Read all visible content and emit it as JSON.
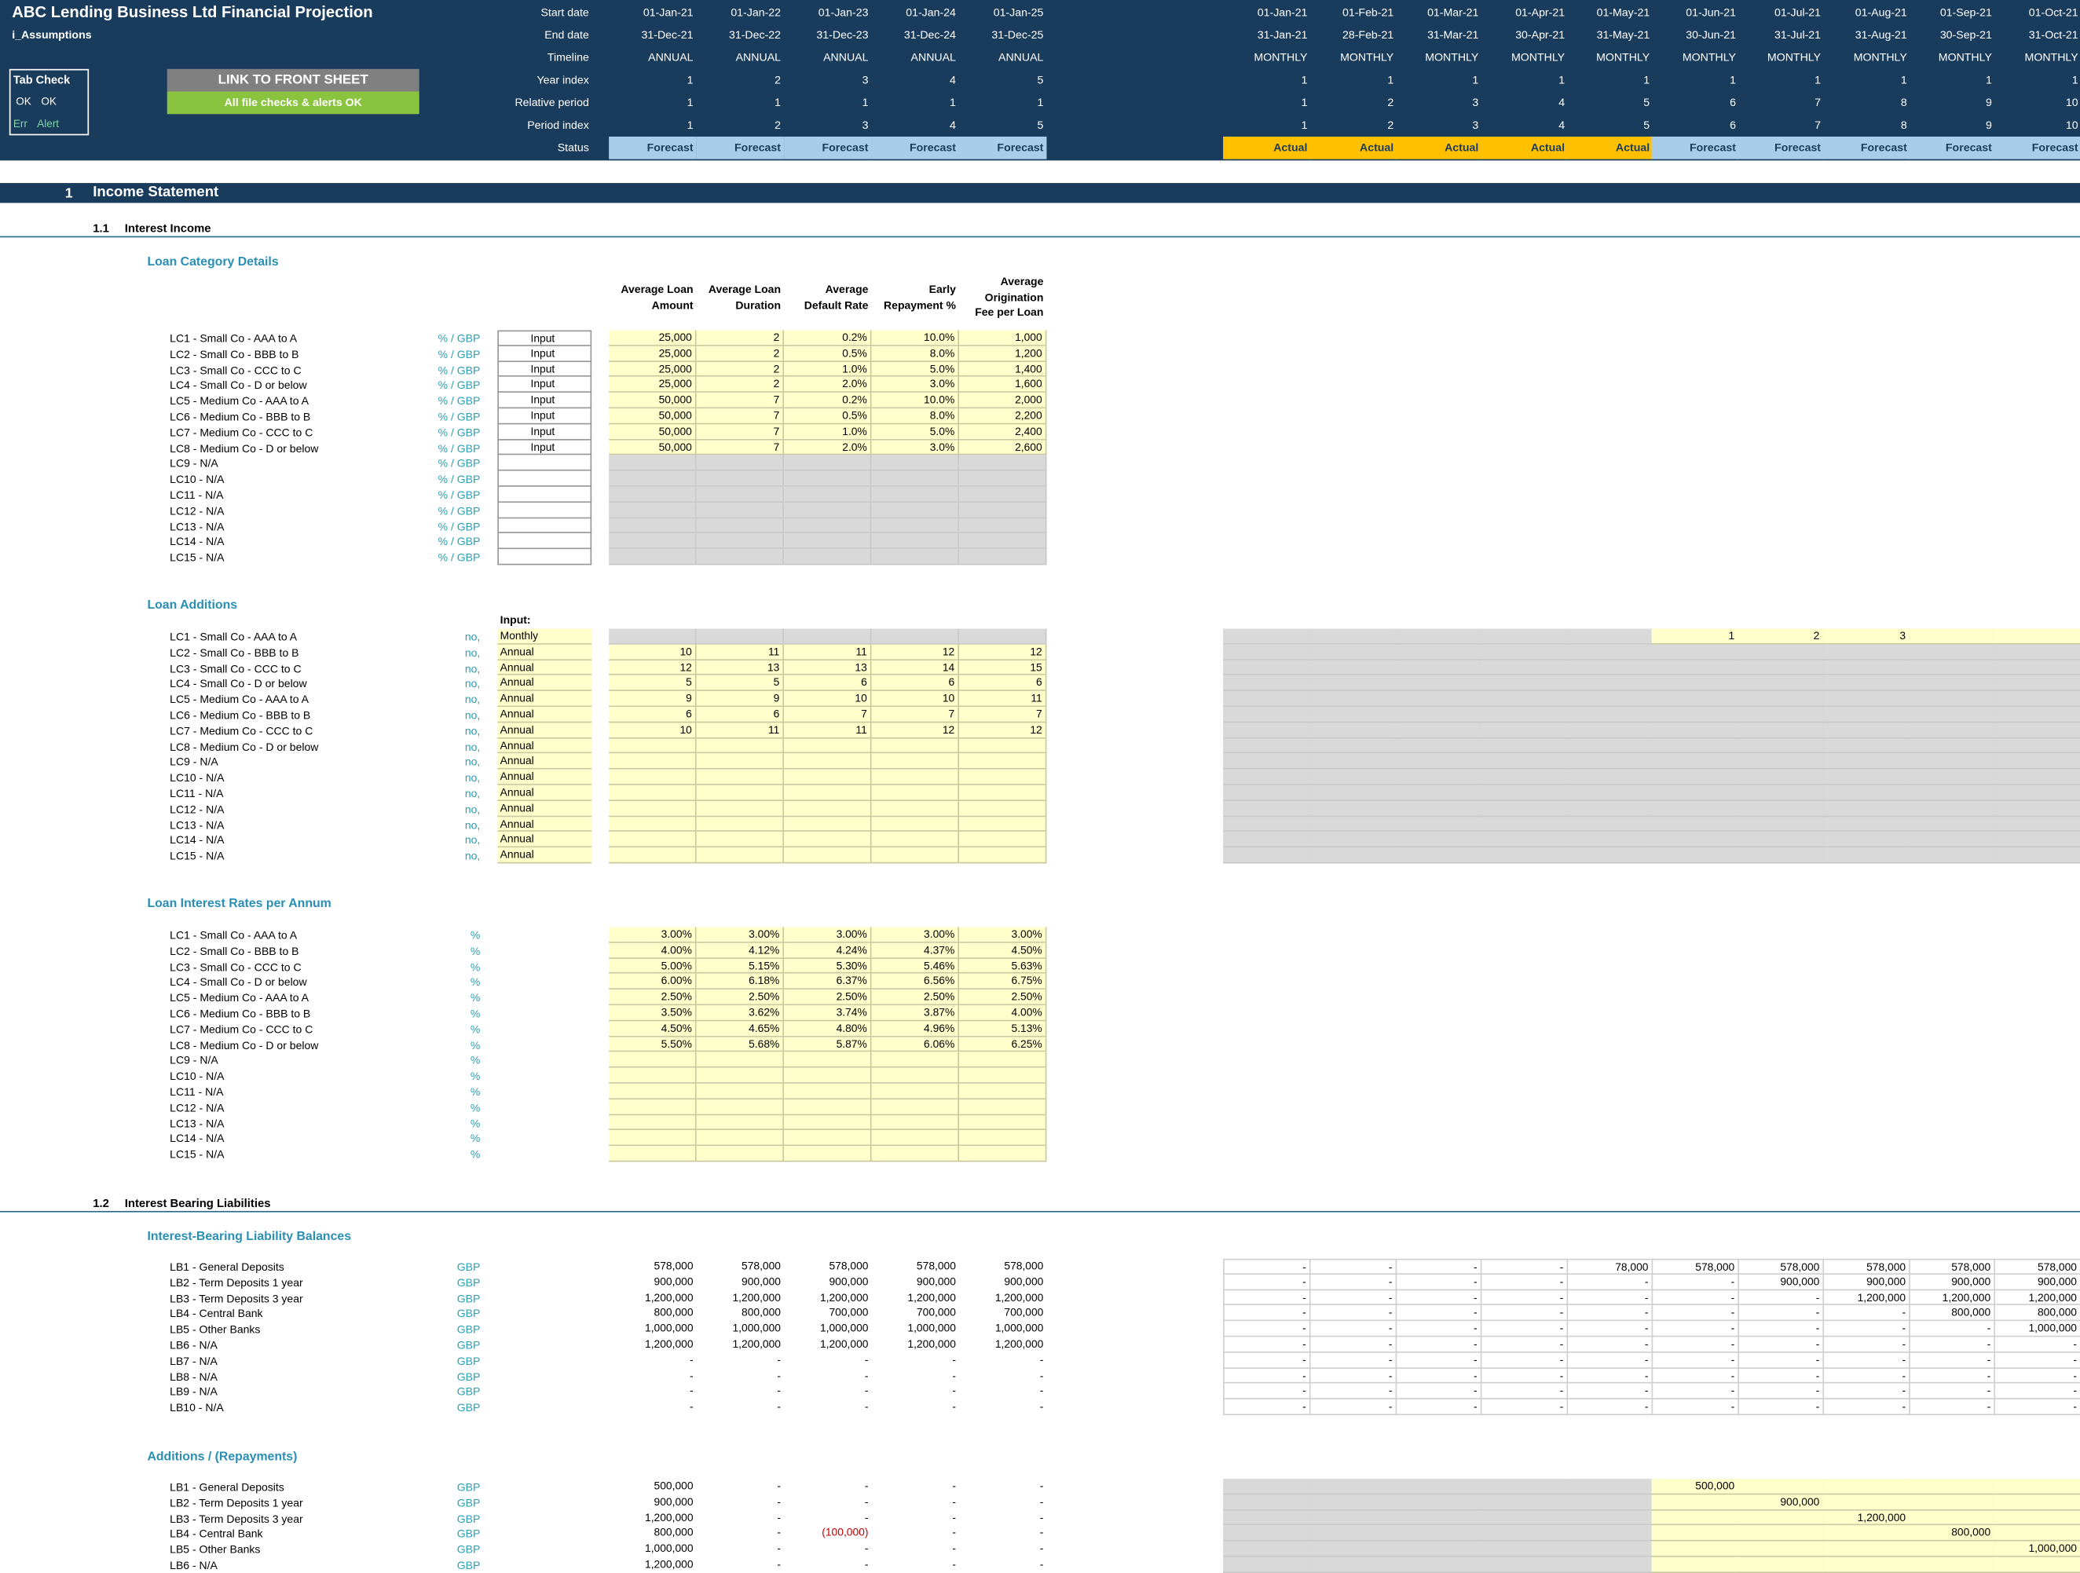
{
  "header": {
    "title": "ABC Lending Business Ltd Financial Projection",
    "sheet_name": "i_Assumptions",
    "tab_check": {
      "label": "Tab Check",
      "ok1": "OK",
      "ok2": "OK",
      "err": "Err",
      "alert": "Alert"
    },
    "link_button": "LINK TO FRONT SHEET",
    "checks_status": "All file checks & alerts OK",
    "row_labels": [
      "Start date",
      "End date",
      "Timeline",
      "Year index",
      "Relative period",
      "Period index",
      "Status"
    ],
    "annual": {
      "start": [
        "01-Jan-21",
        "01-Jan-22",
        "01-Jan-23",
        "01-Jan-24",
        "01-Jan-25"
      ],
      "end": [
        "31-Dec-21",
        "31-Dec-22",
        "31-Dec-23",
        "31-Dec-24",
        "31-Dec-25"
      ],
      "timeline": [
        "ANNUAL",
        "ANNUAL",
        "ANNUAL",
        "ANNUAL",
        "ANNUAL"
      ],
      "year_index": [
        "1",
        "2",
        "3",
        "4",
        "5"
      ],
      "relative": [
        "1",
        "1",
        "1",
        "1",
        "1"
      ],
      "period": [
        "1",
        "2",
        "3",
        "4",
        "5"
      ],
      "status": [
        "Forecast",
        "Forecast",
        "Forecast",
        "Forecast",
        "Forecast"
      ]
    },
    "monthly": {
      "start": [
        "01-Jan-21",
        "01-Feb-21",
        "01-Mar-21",
        "01-Apr-21",
        "01-May-21",
        "01-Jun-21",
        "01-Jul-21",
        "01-Aug-21",
        "01-Sep-21",
        "01-Oct-21"
      ],
      "end": [
        "31-Jan-21",
        "28-Feb-21",
        "31-Mar-21",
        "30-Apr-21",
        "31-May-21",
        "30-Jun-21",
        "31-Jul-21",
        "31-Aug-21",
        "30-Sep-21",
        "31-Oct-21"
      ],
      "timeline": [
        "MONTHLY",
        "MONTHLY",
        "MONTHLY",
        "MONTHLY",
        "MONTHLY",
        "MONTHLY",
        "MONTHLY",
        "MONTHLY",
        "MONTHLY",
        "MONTHLY"
      ],
      "year_index": [
        "1",
        "1",
        "1",
        "1",
        "1",
        "1",
        "1",
        "1",
        "1",
        "1"
      ],
      "relative": [
        "1",
        "2",
        "3",
        "4",
        "5",
        "6",
        "7",
        "8",
        "9",
        "10"
      ],
      "period": [
        "1",
        "2",
        "3",
        "4",
        "5",
        "6",
        "7",
        "8",
        "9",
        "10"
      ],
      "status": [
        "Actual",
        "Actual",
        "Actual",
        "Actual",
        "Actual",
        "Forecast",
        "Forecast",
        "Forecast",
        "Forecast",
        "Forecast"
      ]
    }
  },
  "colors": {
    "header_bg": "#1a3c5c",
    "forecast": "#a9cce9",
    "actual": "#ffc000",
    "input": "#ffffcc",
    "grey": "#d9d9d9",
    "link_button": "#808080",
    "checks_ok": "#8ac43f",
    "heading_teal": "#2a8fb5"
  },
  "section1": {
    "num": "1",
    "title": "Income Statement"
  },
  "s11": {
    "num": "1.1",
    "title": "Interest Income"
  },
  "s12": {
    "num": "1.2",
    "title": "Interest Bearing Liabilities"
  },
  "loan_cat": {
    "title": "Loan Category Details",
    "headers": [
      [
        "Average Loan",
        "Amount"
      ],
      [
        "Average Loan",
        "Duration"
      ],
      [
        "Average",
        "Default Rate"
      ],
      [
        "Early",
        "Repayment %"
      ],
      [
        "Average",
        "Origination",
        "Fee per Loan"
      ]
    ],
    "labels": [
      "LC1 - Small Co - AAA to A",
      "LC2 - Small Co - BBB to B",
      "LC3 - Small Co - CCC to C",
      "LC4 - Small Co - D or below",
      "LC5 - Medium Co - AAA to A",
      "LC6 - Medium Co - BBB to B",
      "LC7 - Medium Co - CCC to C",
      "LC8 - Medium Co - D or below",
      "LC9 - N/A",
      "LC10 - N/A",
      "LC11 - N/A",
      "LC12 - N/A",
      "LC13 - N/A",
      "LC14 - N/A",
      "LC15 - N/A"
    ],
    "unit": "% / GBP",
    "input_label": "Input",
    "values": [
      [
        "25,000",
        "2",
        "0.2%",
        "10.0%",
        "1,000"
      ],
      [
        "25,000",
        "2",
        "0.5%",
        "8.0%",
        "1,200"
      ],
      [
        "25,000",
        "2",
        "1.0%",
        "5.0%",
        "1,400"
      ],
      [
        "25,000",
        "2",
        "2.0%",
        "3.0%",
        "1,600"
      ],
      [
        "50,000",
        "7",
        "0.2%",
        "10.0%",
        "2,000"
      ],
      [
        "50,000",
        "7",
        "0.5%",
        "8.0%",
        "2,200"
      ],
      [
        "50,000",
        "7",
        "1.0%",
        "5.0%",
        "2,400"
      ],
      [
        "50,000",
        "7",
        "2.0%",
        "3.0%",
        "2,600"
      ]
    ]
  },
  "loan_add": {
    "title": "Loan Additions",
    "input_header": "Input:",
    "unit": "no,",
    "freq": [
      "Monthly",
      "Annual",
      "Annual",
      "Annual",
      "Annual",
      "Annual",
      "Annual",
      "Annual",
      "Annual",
      "Annual",
      "Annual",
      "Annual",
      "Annual",
      "Annual",
      "Annual"
    ],
    "values": [
      [
        "",
        "",
        "",
        "",
        ""
      ],
      [
        "10",
        "11",
        "11",
        "12",
        "12"
      ],
      [
        "12",
        "13",
        "13",
        "14",
        "15"
      ],
      [
        "5",
        "5",
        "6",
        "6",
        "6"
      ],
      [
        "9",
        "9",
        "10",
        "10",
        "11"
      ],
      [
        "6",
        "6",
        "7",
        "7",
        "7"
      ],
      [
        "10",
        "11",
        "11",
        "12",
        "12"
      ]
    ],
    "monthly_row1": [
      "",
      "",
      "",
      "",
      "",
      "1",
      "2",
      "3",
      "",
      ""
    ]
  },
  "loan_rates": {
    "title": "Loan Interest Rates per Annum",
    "unit": "%",
    "values": [
      [
        "3.00%",
        "3.00%",
        "3.00%",
        "3.00%",
        "3.00%"
      ],
      [
        "4.00%",
        "4.12%",
        "4.24%",
        "4.37%",
        "4.50%"
      ],
      [
        "5.00%",
        "5.15%",
        "5.30%",
        "5.46%",
        "5.63%"
      ],
      [
        "6.00%",
        "6.18%",
        "6.37%",
        "6.56%",
        "6.75%"
      ],
      [
        "2.50%",
        "2.50%",
        "2.50%",
        "2.50%",
        "2.50%"
      ],
      [
        "3.50%",
        "3.62%",
        "3.74%",
        "3.87%",
        "4.00%"
      ],
      [
        "4.50%",
        "4.65%",
        "4.80%",
        "4.96%",
        "5.13%"
      ],
      [
        "5.50%",
        "5.68%",
        "5.87%",
        "6.06%",
        "6.25%"
      ]
    ]
  },
  "liab_bal": {
    "title": "Interest-Bearing Liability Balances",
    "labels": [
      "LB1 - General Deposits",
      "LB2 - Term Deposits 1 year",
      "LB3 - Term Deposits 3 year",
      "LB4 - Central Bank",
      "LB5 - Other Banks",
      "LB6 - N/A",
      "LB7 - N/A",
      "LB8 - N/A",
      "LB9 - N/A",
      "LB10 - N/A"
    ],
    "unit": "GBP",
    "annual": [
      [
        "578,000",
        "578,000",
        "578,000",
        "578,000",
        "578,000"
      ],
      [
        "900,000",
        "900,000",
        "900,000",
        "900,000",
        "900,000"
      ],
      [
        "1,200,000",
        "1,200,000",
        "1,200,000",
        "1,200,000",
        "1,200,000"
      ],
      [
        "800,000",
        "800,000",
        "700,000",
        "700,000",
        "700,000"
      ],
      [
        "1,000,000",
        "1,000,000",
        "1,000,000",
        "1,000,000",
        "1,000,000"
      ],
      [
        "1,200,000",
        "1,200,000",
        "1,200,000",
        "1,200,000",
        "1,200,000"
      ],
      [
        "-",
        "-",
        "-",
        "-",
        "-"
      ],
      [
        "-",
        "-",
        "-",
        "-",
        "-"
      ],
      [
        "-",
        "-",
        "-",
        "-",
        "-"
      ],
      [
        "-",
        "-",
        "-",
        "-",
        "-"
      ]
    ],
    "monthly": [
      [
        "-",
        "-",
        "-",
        "-",
        "78,000",
        "578,000",
        "578,000",
        "578,000",
        "578,000",
        "578,000"
      ],
      [
        "-",
        "-",
        "-",
        "-",
        "-",
        "-",
        "900,000",
        "900,000",
        "900,000",
        "900,000"
      ],
      [
        "-",
        "-",
        "-",
        "-",
        "-",
        "-",
        "-",
        "1,200,000",
        "1,200,000",
        "1,200,000"
      ],
      [
        "-",
        "-",
        "-",
        "-",
        "-",
        "-",
        "-",
        "-",
        "800,000",
        "800,000"
      ],
      [
        "-",
        "-",
        "-",
        "-",
        "-",
        "-",
        "-",
        "-",
        "-",
        "1,000,000"
      ],
      [
        "-",
        "-",
        "-",
        "-",
        "-",
        "-",
        "-",
        "-",
        "-",
        "-"
      ],
      [
        "-",
        "-",
        "-",
        "-",
        "-",
        "-",
        "-",
        "-",
        "-",
        "-"
      ],
      [
        "-",
        "-",
        "-",
        "-",
        "-",
        "-",
        "-",
        "-",
        "-",
        "-"
      ],
      [
        "-",
        "-",
        "-",
        "-",
        "-",
        "-",
        "-",
        "-",
        "-",
        "-"
      ],
      [
        "-",
        "-",
        "-",
        "-",
        "-",
        "-",
        "-",
        "-",
        "-",
        "-"
      ]
    ]
  },
  "liab_add": {
    "title": "Additions / (Repayments)",
    "labels": [
      "LB1 - General Deposits",
      "LB2 - Term Deposits 1 year",
      "LB3 - Term Deposits 3 year",
      "LB4 - Central Bank",
      "LB5 - Other Banks",
      "LB6 - N/A"
    ],
    "unit": "GBP",
    "annual": [
      [
        "500,000",
        "-",
        "-",
        "-",
        "-"
      ],
      [
        "900,000",
        "-",
        "-",
        "-",
        "-"
      ],
      [
        "1,200,000",
        "-",
        "-",
        "-",
        "-"
      ],
      [
        "800,000",
        "-",
        "(100,000)",
        "-",
        "-"
      ],
      [
        "1,000,000",
        "-",
        "-",
        "-",
        "-"
      ],
      [
        "1,200,000",
        "-",
        "-",
        "-",
        "-"
      ]
    ],
    "monthly": [
      [
        "",
        "",
        "",
        "",
        "",
        "500,000",
        "",
        "",
        "",
        ""
      ],
      [
        "",
        "",
        "",
        "",
        "",
        "",
        "900,000",
        "",
        "",
        ""
      ],
      [
        "",
        "",
        "",
        "",
        "",
        "",
        "",
        "1,200,000",
        "",
        ""
      ],
      [
        "",
        "",
        "",
        "",
        "",
        "",
        "",
        "",
        "800,000",
        ""
      ],
      [
        "",
        "",
        "",
        "",
        "",
        "",
        "",
        "",
        "",
        "1,000,000"
      ],
      [
        "",
        "",
        "",
        "",
        "",
        "",
        "",
        "",
        "",
        ""
      ]
    ]
  }
}
